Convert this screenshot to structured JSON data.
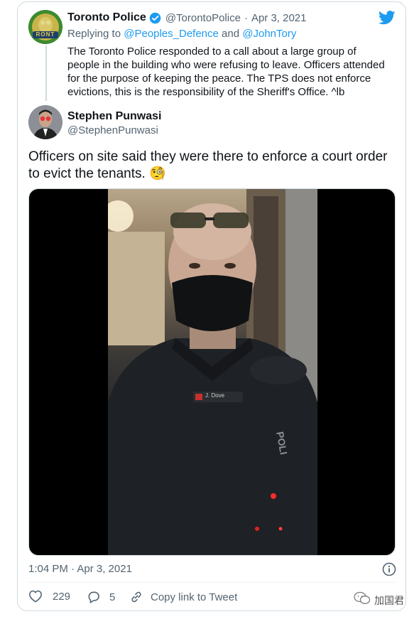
{
  "reply_tweet": {
    "display_name": "Toronto Police",
    "handle": "@TorontoPolice",
    "separator": "·",
    "date": "Apr 3, 2021",
    "replying_prefix": "Replying to",
    "replying_user1": "@Peoples_Defence",
    "replying_and": "and",
    "replying_user2": "@JohnTory",
    "text_lines": [
      "The Toronto Police responded to a call about a large group of",
      "people in the building who were refusing to leave. Officers attended",
      "for the purpose of keeping the peace. The TPS does not enforce",
      "evictions, this is the responsibility of the Sheriff's Office. ^lb"
    ],
    "avatar_text": "RONT"
  },
  "main_tweet": {
    "display_name": "Stephen Punwasi",
    "handle": "@StephenPunwasi",
    "text_line1": "Officers on site said they were there to enforce a court order",
    "text_line2": "to evict the tenants. ",
    "emoji": "🧐",
    "timestamp": "1:04 PM · Apr 3, 2021"
  },
  "video": {
    "name_tag": "J. Dove",
    "vest_text": "POLI"
  },
  "actions": {
    "likes": "229",
    "replies": "5",
    "copy_link": "Copy link to Tweet"
  },
  "watermark": {
    "text": "加国君"
  },
  "colors": {
    "accent": "#1d9bf0",
    "secondary_text": "#536471",
    "border": "#cfd9de"
  }
}
